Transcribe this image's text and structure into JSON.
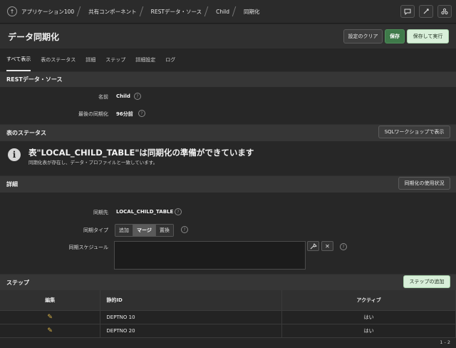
{
  "breadcrumb": {
    "items": [
      "アプリケーション100",
      "共有コンポーネント",
      "RESTデータ・ソース",
      "Child",
      "同期化"
    ]
  },
  "header": {
    "title": "データ同期化",
    "clear_label": "設定のクリア",
    "save_label": "保存",
    "save_run_label": "保存して実行"
  },
  "tabs": [
    "すべて表示",
    "表のステータス",
    "詳細",
    "ステップ",
    "詳細設定",
    "ログ"
  ],
  "rest_source": {
    "heading": "RESTデータ・ソース",
    "name_label": "名前",
    "name_value": "Child",
    "last_sync_label": "最後の同期化",
    "last_sync_value": "96分前"
  },
  "table_status": {
    "heading": "表のステータス",
    "sql_button": "SQLワークショップで表示",
    "message_title": "表\"LOCAL_CHILD_TABLE\"は同期化の準備ができています",
    "message_sub": "同期化表が存在し、データ・プロファイルと一致しています。"
  },
  "details": {
    "heading": "詳細",
    "usage_button": "同期化の使用状況",
    "target_label": "同期先",
    "target_value": "LOCAL_CHILD_TABLE",
    "type_label": "同期タイプ",
    "type_options": [
      "追加",
      "マージ",
      "置換"
    ],
    "type_selected": "マージ",
    "schedule_label": "同期スケジュール",
    "schedule_value": ""
  },
  "steps": {
    "heading": "ステップ",
    "add_button": "ステップの追加",
    "columns": [
      "編集",
      "静的ID",
      "アクティブ"
    ],
    "rows": [
      {
        "static_id": "DEPTNO 10",
        "active": "はい"
      },
      {
        "static_id": "DEPTNO 20",
        "active": "はい"
      }
    ],
    "pagination": "1 - 2"
  },
  "colors": {
    "background": "#262626",
    "primary_button": "#3f7a4a",
    "light_button": "#d8efd9"
  }
}
